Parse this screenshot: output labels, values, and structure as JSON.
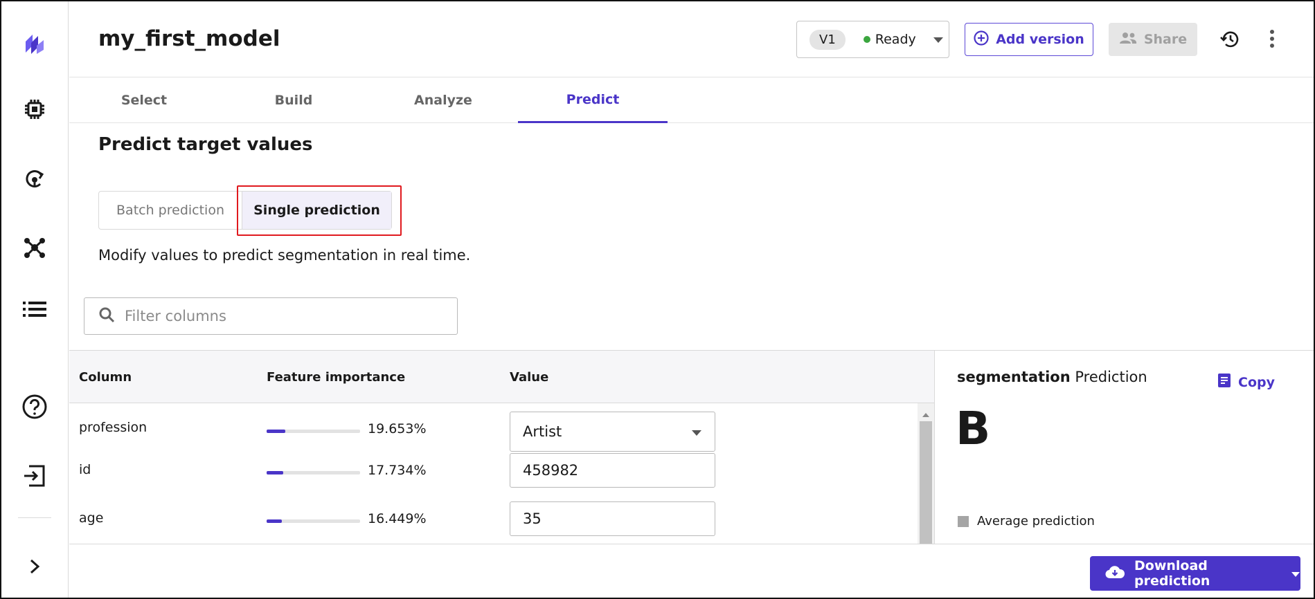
{
  "header": {
    "model_name": "my_first_model",
    "version": "V1",
    "status": "Ready",
    "add_version_label": "Add version",
    "share_label": "Share"
  },
  "rail": {
    "icons": [
      "logo-icon",
      "chip-icon",
      "refresh-model-icon",
      "network-icon",
      "list-icon",
      "help-icon",
      "logout-icon",
      "expand-chevron-icon"
    ]
  },
  "tabs": [
    "Select",
    "Build",
    "Analyze",
    "Predict"
  ],
  "active_tab": "Predict",
  "content": {
    "title": "Predict target values",
    "mode_batch": "Batch prediction",
    "mode_single": "Single prediction",
    "description": "Modify values to predict segmentation in real time.",
    "filter_placeholder": "Filter columns"
  },
  "table": {
    "headers": {
      "column": "Column",
      "importance": "Feature importance",
      "value": "Value"
    },
    "rows": [
      {
        "column": "profession",
        "importance_label": "19.653%",
        "importance": 19.653,
        "value": "Artist"
      },
      {
        "column": "id",
        "importance_label": "17.734%",
        "importance": 17.734,
        "value": "458982"
      },
      {
        "column": "age",
        "importance_label": "16.449%",
        "importance": 16.449,
        "value": "35"
      }
    ]
  },
  "prediction": {
    "target": "segmentation",
    "label": "Prediction",
    "copy_label": "Copy",
    "value": "B",
    "average_label": "Average prediction"
  },
  "footer": {
    "download_label": "Download prediction"
  },
  "colors": {
    "accent": "#4a35c8",
    "ready": "#3ba63f",
    "highlight": "#e0191e"
  }
}
